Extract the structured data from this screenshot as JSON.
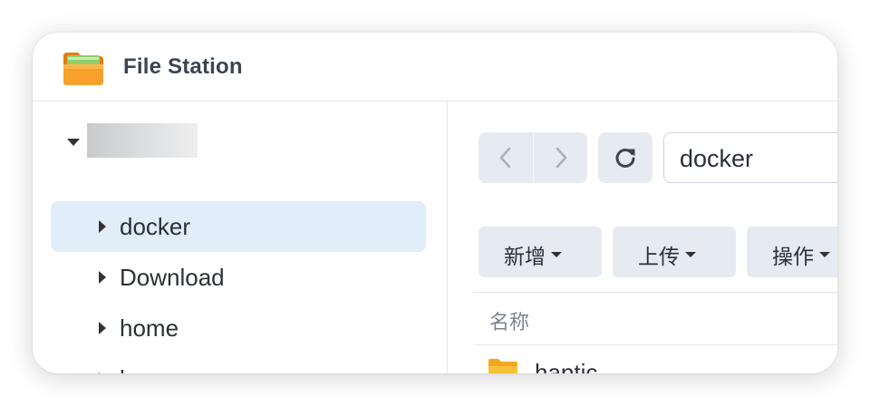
{
  "app": {
    "title": "File Station",
    "icon": "folder-app-icon"
  },
  "sidebar": {
    "root": {
      "icon": "caret-down-icon",
      "name_redacted": true
    },
    "items": [
      {
        "label": "docker",
        "selected": true
      },
      {
        "label": "Download",
        "selected": false
      },
      {
        "label": "home",
        "selected": false
      },
      {
        "label": "homes",
        "selected": false
      }
    ]
  },
  "toolbar": {
    "back_icon": "chevron-left-icon",
    "forward_icon": "chevron-right-icon",
    "refresh_icon": "refresh-icon",
    "path_value": "docker",
    "buttons": [
      {
        "label": "新增"
      },
      {
        "label": "上传"
      },
      {
        "label": "操作"
      }
    ]
  },
  "table": {
    "columns": [
      {
        "label": "名称"
      }
    ],
    "rows": [
      {
        "name": "haptic",
        "icon": "folder-icon"
      }
    ]
  },
  "colors": {
    "selection_bg": "#e2edfa",
    "button_bg": "#e6ebf1",
    "folder_yellow": "#f8c13a",
    "app_icon_orange": "#f39a1e"
  }
}
